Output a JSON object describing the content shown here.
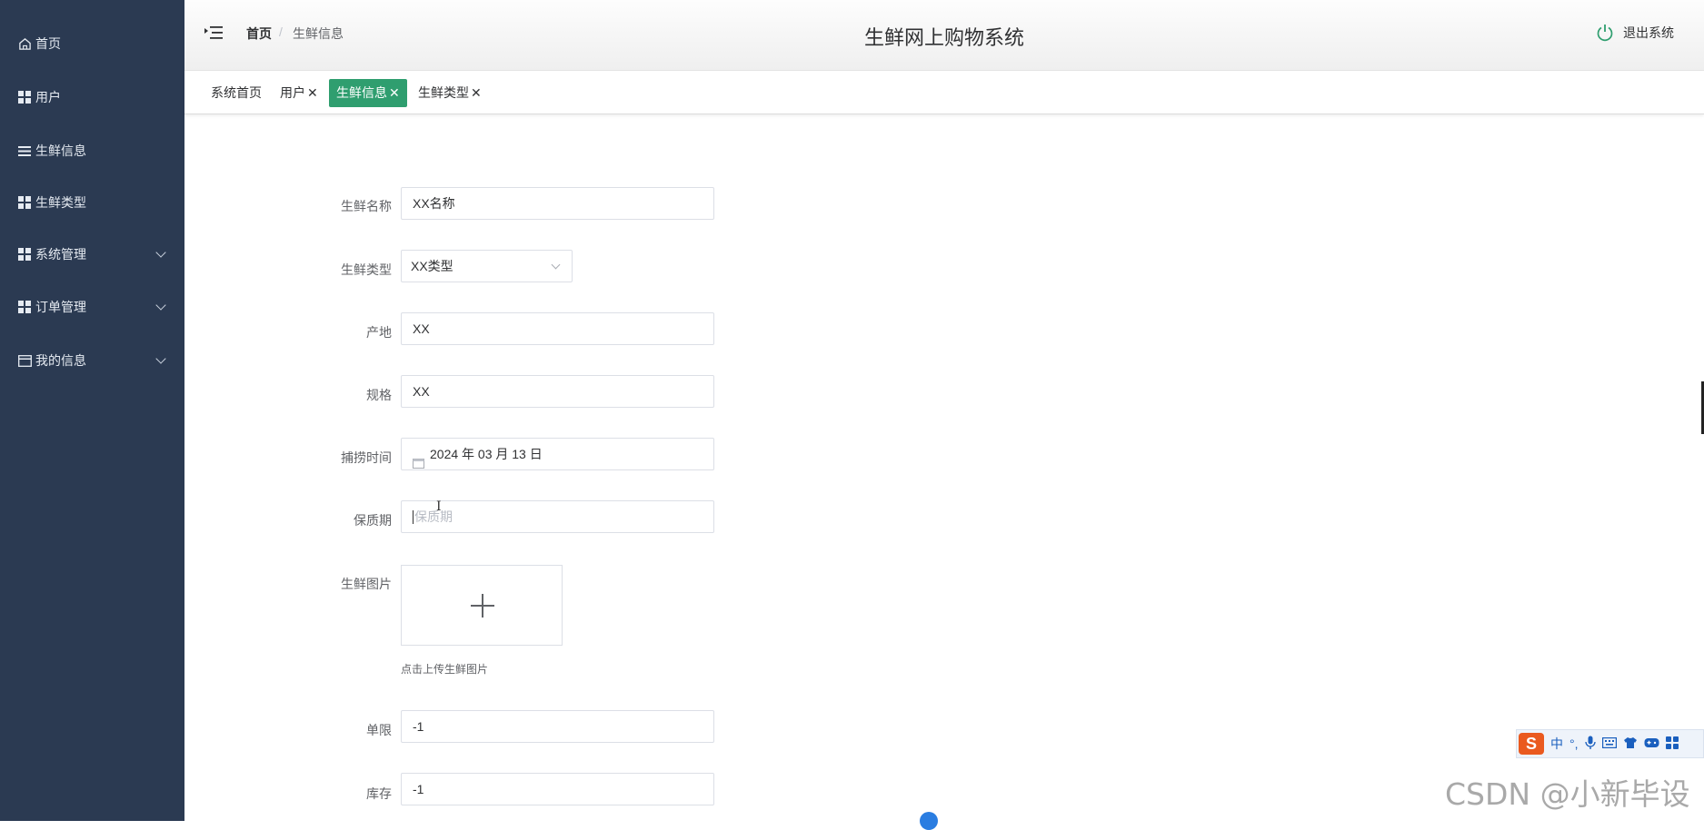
{
  "sidebar": {
    "items": [
      {
        "label": "首页",
        "icon": "home-icon",
        "has_submenu": false
      },
      {
        "label": "用户",
        "icon": "grid-icon",
        "has_submenu": false
      },
      {
        "label": "生鲜信息",
        "icon": "list-icon",
        "has_submenu": false
      },
      {
        "label": "生鲜类型",
        "icon": "grid-icon",
        "has_submenu": false
      },
      {
        "label": "系统管理",
        "icon": "grid-icon",
        "has_submenu": true
      },
      {
        "label": "订单管理",
        "icon": "grid-icon",
        "has_submenu": true
      },
      {
        "label": "我的信息",
        "icon": "card-icon",
        "has_submenu": true
      }
    ]
  },
  "header": {
    "breadcrumb_home": "首页",
    "breadcrumb_sep": "/",
    "breadcrumb_current": "生鲜信息",
    "title": "生鲜网上购物系统",
    "logout_label": "退出系统"
  },
  "tags": [
    {
      "label": "系统首页",
      "closable": false,
      "active": false
    },
    {
      "label": "用户",
      "closable": true,
      "active": false
    },
    {
      "label": "生鲜信息",
      "closable": true,
      "active": true
    },
    {
      "label": "生鲜类型",
      "closable": true,
      "active": false
    }
  ],
  "form": {
    "name": {
      "label": "生鲜名称",
      "value": "XX名称"
    },
    "type": {
      "label": "生鲜类型",
      "value": "XX类型"
    },
    "origin": {
      "label": "产地",
      "value": "XX"
    },
    "spec": {
      "label": "规格",
      "value": "XX"
    },
    "catch_time": {
      "label": "捕捞时间",
      "value": "2024 年 03 月 13 日"
    },
    "shelf_life": {
      "label": "保质期",
      "placeholder": "保质期"
    },
    "image": {
      "label": "生鲜图片",
      "tip": "点击上传生鲜图片"
    },
    "limit": {
      "label": "单限",
      "value": "-1"
    },
    "stock": {
      "label": "库存",
      "value": "-1"
    }
  },
  "ime": {
    "logo": "S",
    "mode": "中",
    "punct": "°,",
    "icons": [
      "mic-icon",
      "keyboard-icon",
      "shirt-icon",
      "gamepad-icon",
      "apps-icon"
    ]
  },
  "watermark": "CSDN @小新毕设",
  "colors": {
    "sidebar": "#2b3a52",
    "accent": "#2f9e6f"
  }
}
